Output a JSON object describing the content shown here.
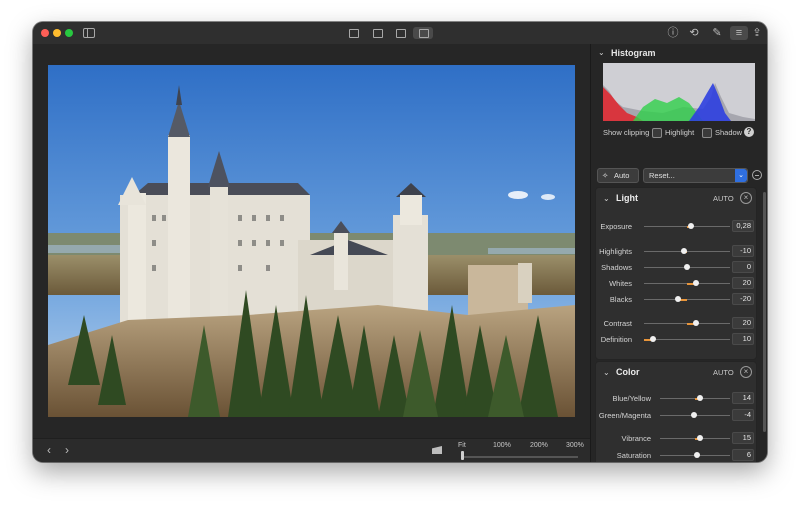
{
  "toolbar": {
    "icons": [
      "sidebar-icon",
      "grid-view-icon",
      "filmstrip-view-icon",
      "split-view-icon",
      "single-view-icon",
      "info-icon",
      "crop-rotate-icon",
      "retouch-icon",
      "adjust-icon",
      "share-icon"
    ],
    "info_glyph": "ⓘ",
    "crop_glyph": "⟲",
    "retouch_glyph": "✎",
    "adjust_glyph": "≡",
    "share_glyph": "⇪"
  },
  "viewer": {
    "prev_glyph": "‹",
    "next_glyph": "›",
    "zoom_fit": "Fit",
    "zoom_100": "100%",
    "zoom_200": "200%",
    "zoom_300": "300%",
    "zoom_level": 0
  },
  "histogram": {
    "title": "Histogram",
    "show_clipping": "Show clipping",
    "highlight": "Highlight",
    "shadow": "Shadow",
    "help": "?"
  },
  "presets": {
    "auto_label": "Auto",
    "preset_value": "Reset...",
    "arrow": "⌄"
  },
  "light": {
    "title": "Light",
    "auto": "AUTO",
    "close": "×",
    "adjustments": [
      {
        "label": "Exposure",
        "value": "0,28",
        "pos": 0.55
      },
      {
        "label": "Highlights",
        "value": "-10",
        "pos": 0.47
      },
      {
        "label": "Shadows",
        "value": "0",
        "pos": 0.5
      },
      {
        "label": "Whites",
        "value": "20",
        "pos": 0.6
      },
      {
        "label": "Blacks",
        "value": "-20",
        "pos": 0.4
      },
      {
        "label": "Contrast",
        "value": "20",
        "pos": 0.6
      },
      {
        "label": "Definition",
        "value": "10",
        "pos": 0.1
      }
    ]
  },
  "color": {
    "title": "Color",
    "auto": "AUTO",
    "close": "×",
    "adjustments": [
      {
        "label": "Blue/Yellow",
        "value": "14",
        "pos": 0.57
      },
      {
        "label": "Green/Magenta",
        "value": "-4",
        "pos": 0.48
      },
      {
        "label": "Vibrance",
        "value": "15",
        "pos": 0.57
      },
      {
        "label": "Saturation",
        "value": "6",
        "pos": 0.53
      }
    ]
  },
  "colors": {
    "accent": "#2f6fe0",
    "slider_fill": "#e8953a",
    "sky": "#3f7fd0"
  }
}
